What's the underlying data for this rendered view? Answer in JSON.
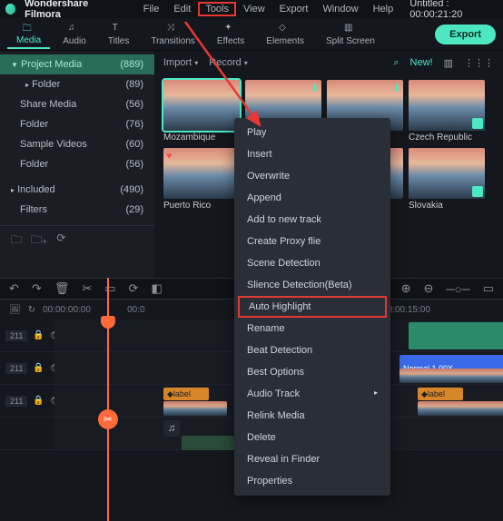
{
  "app": {
    "name": "Wondershare Filmora",
    "title_right": "Untitled : 00:00:21:20"
  },
  "menubar": [
    "File",
    "Edit",
    "Tools",
    "View",
    "Export",
    "Window",
    "Help"
  ],
  "menubar_highlight_index": 2,
  "tabs": [
    {
      "label": "Media"
    },
    {
      "label": "Audio"
    },
    {
      "label": "Titles"
    },
    {
      "label": "Transitions"
    },
    {
      "label": "Effects"
    },
    {
      "label": "Elements"
    },
    {
      "label": "Split Screen"
    }
  ],
  "export_label": "Export",
  "sidebar": {
    "header": {
      "label": "Project Media",
      "count": "(889)",
      "tri": "▼"
    },
    "items": [
      {
        "label": "Folder",
        "count": "(89)",
        "tri": "▸"
      },
      {
        "label": "Share Media",
        "count": "(56)"
      },
      {
        "label": "Folder",
        "count": "(76)"
      },
      {
        "label": "Sample Videos",
        "count": "(60)"
      },
      {
        "label": "Folder",
        "count": "(56)"
      }
    ],
    "sections": [
      {
        "label": "Included",
        "count": "(490)",
        "tri": "▸"
      },
      {
        "label": "Filters",
        "count": "(29)"
      }
    ]
  },
  "browser": {
    "import": "Import",
    "record": "Record",
    "search_ico": "⌕",
    "new": "New!",
    "filter_ico": "⋮⋮",
    "sort_ico": "▤",
    "grid_ico": "⋮⋮⋮"
  },
  "thumbs": [
    {
      "label": "Mozambique",
      "selected": true
    },
    {
      "label": "",
      "download": true
    },
    {
      "label": "",
      "download": true
    },
    {
      "label": "Czech Republic",
      "checked": true
    },
    {
      "label": "Puerto Rico",
      "heart": true
    },
    {
      "label": ""
    },
    {
      "label": ""
    },
    {
      "label": "Slovakia",
      "checked": true
    }
  ],
  "toolbar_icons": [
    "↶",
    "↷",
    "🗑",
    "✂",
    "▭",
    "⟳",
    "◧",
    "⋯"
  ],
  "toolbar_right": [
    "⊕",
    "⊖",
    "─○─",
    "▭",
    "⤢"
  ],
  "timeline": {
    "head": [
      "🖼",
      "↻"
    ],
    "timecodes": [
      "00:00:00:00",
      "00:0",
      "",
      "00:00:15:00"
    ],
    "tracks": [
      {
        "id": "211",
        "lock": "🔒",
        "eye": "👁"
      },
      {
        "id": "211",
        "lock": "🔒",
        "eye": "👁"
      },
      {
        "id": "211",
        "lock": "🔒",
        "eye": "👁"
      },
      {
        "id": "",
        "lock": "",
        "eye": ""
      }
    ],
    "clip_label": "label",
    "blue_clip": "Normal 1.00X",
    "audio_ico": "♫"
  },
  "context_menu": [
    "Play",
    "Insert",
    "Overwrite",
    "Append",
    "Add to new track",
    "Create Proxy flie",
    "Scene Detection",
    "Slience Detection(Beta)",
    "Auto Highlight",
    "Rename",
    "Beat Detection",
    "Best Options",
    "Audio Track",
    "Relink Media",
    "Delete",
    "Reveal in Finder",
    "Properties"
  ],
  "context_highlight_index": 8,
  "colors": {
    "accent": "#4de8c2",
    "highlight_box": "#e53935",
    "playhead": "#ff6a3a"
  }
}
